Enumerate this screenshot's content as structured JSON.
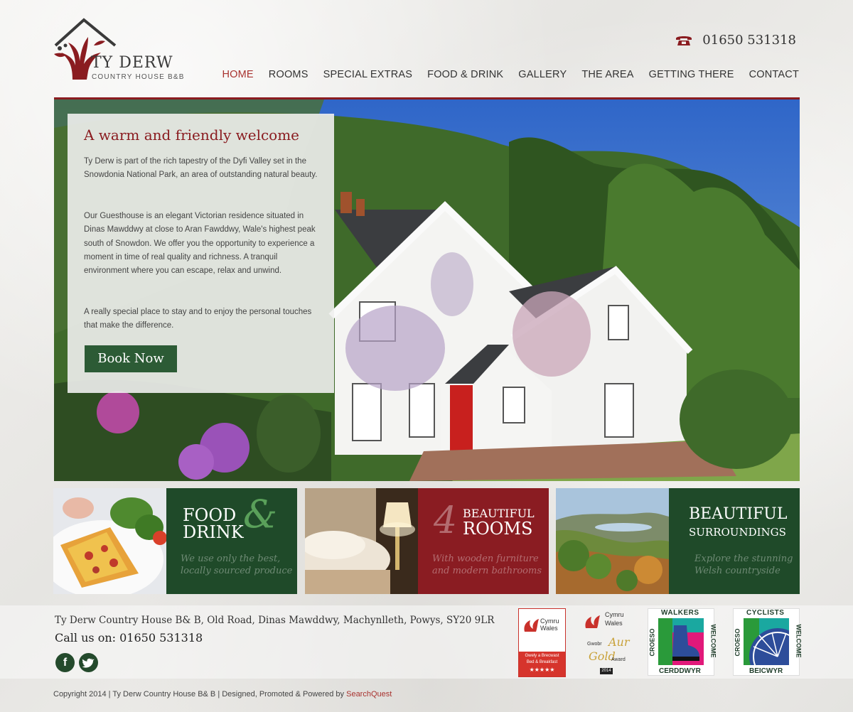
{
  "brand": {
    "name": "TY DERW",
    "tagline": "COUNTRY HOUSE B&B"
  },
  "header": {
    "phone": "01650 531318"
  },
  "nav": [
    {
      "label": "HOME",
      "active": true
    },
    {
      "label": "ROOMS",
      "active": false
    },
    {
      "label": "SPECIAL EXTRAS",
      "active": false
    },
    {
      "label": "FOOD & DRINK",
      "active": false
    },
    {
      "label": "GALLERY",
      "active": false
    },
    {
      "label": "THE AREA",
      "active": false
    },
    {
      "label": "GETTING THERE",
      "active": false
    },
    {
      "label": "CONTACT",
      "active": false
    }
  ],
  "welcome": {
    "title": "A warm and friendly welcome",
    "p1": "Ty Derw is part of the rich tapestry of the Dyfi Valley set in the Snowdonia National Park, an area of outstanding natural beauty.",
    "p2": "Our Guesthouse is an elegant Victorian residence situated in Dinas Mawddwy at close to Aran Fawddwy, Wale's highest peak south of Snowdon. We offer you the opportunity to experience a moment in time of real quality and richness. A tranquil environment where you can escape, relax and unwind.",
    "p3": "A really special place to stay and to enjoy the personal touches that make the difference.",
    "button": "Book Now"
  },
  "tiles": {
    "food": {
      "line1": "FOOD",
      "line2": "DRINK",
      "amp": "&",
      "sub1": "We use only the best,",
      "sub2": "locally sourced produce"
    },
    "rooms": {
      "number": "4",
      "line1": "BEAUTIFUL",
      "line2": "ROOMS",
      "sub1": "With wooden furniture",
      "sub2": "and modern bathrooms"
    },
    "surroundings": {
      "line1": "BEAUTIFUL",
      "line2": "SURROUNDINGS",
      "sub1": "Explore the stunning",
      "sub2": "Welsh countryside"
    }
  },
  "footer": {
    "address": "Ty Derw Country House B& B, Old Road, Dinas Mawddwy, Machynlleth, Powys, SY20 9LR",
    "call": "Call us on: 01650 531318",
    "copyright_main": "Copyright 2014 | Ty Derw Country House B& B  |   Designed, Promoted & Powered by ",
    "copyright_link": "SearchQuest",
    "social": {
      "facebook": "f",
      "twitter": "t"
    }
  },
  "badges": {
    "visitwales": {
      "line1": "Cymru",
      "line2": "Wales",
      "sub1": "Gwely a Brecwast",
      "sub2": "Bed & Breakfast",
      "stars": "★★★★★"
    },
    "gold": {
      "line1": "Cymru",
      "line2": "Wales",
      "gwobr": "Gwobr",
      "aur": "Aur",
      "gold": "Gold",
      "award": "Award",
      "year": "2014"
    },
    "walkers": {
      "top": "WALKERS",
      "left": "CROESO",
      "right": "WELCOME",
      "bottom": "CERDDWYR"
    },
    "cyclists": {
      "top": "CYCLISTS",
      "left": "CROESO",
      "right": "WELCOME",
      "bottom": "BEICWYR"
    }
  },
  "colors": {
    "accent_red": "#8a1c20",
    "green": "#1f4a29",
    "button_green": "#2c5b35"
  }
}
